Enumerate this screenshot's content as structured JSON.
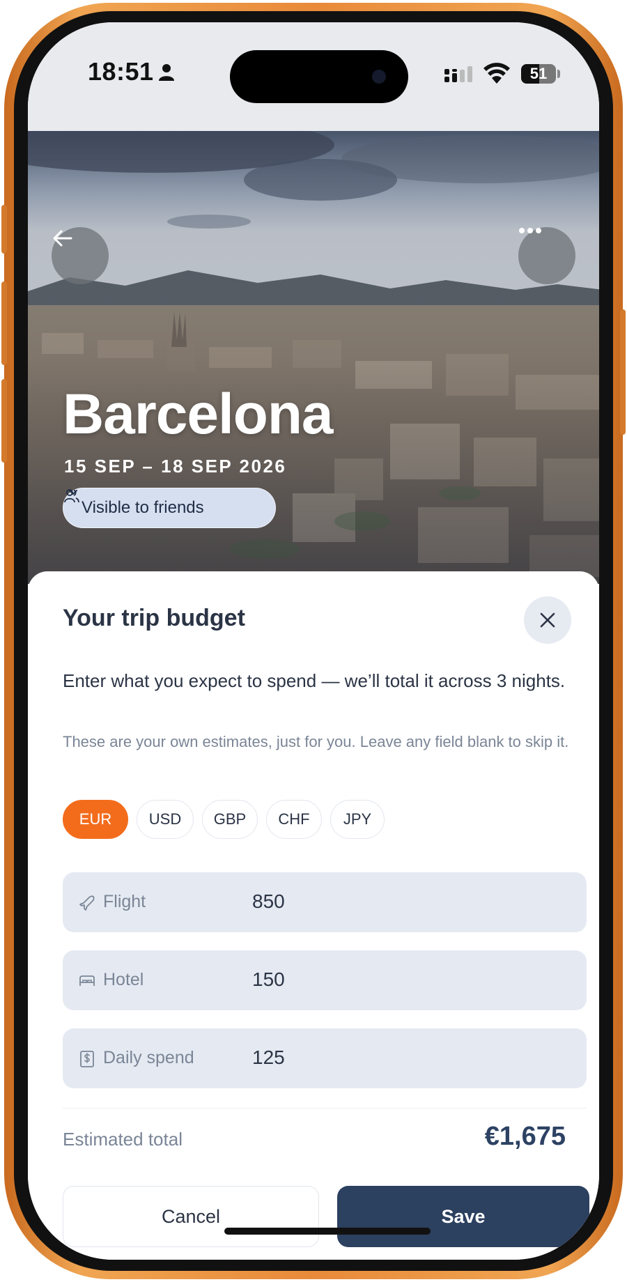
{
  "status_bar": {
    "time": "18:51",
    "battery": "51"
  },
  "hero": {
    "city": "Barcelona",
    "dates": "15 SEP – 18 SEP 2026",
    "visibility_label": "Visible to friends",
    "icons": [
      "arrow-left-icon",
      "more-horizontal-icon",
      "users-icon",
      "chevron-down-icon"
    ]
  },
  "budget": {
    "title": "Your trip budget",
    "intro": "Enter what you expect to spend — we’ll total it across 3 nights.",
    "note": "These are your own estimates, just for you. Leave any field blank to skip it.",
    "currencies": [
      "EUR",
      "USD",
      "GBP",
      "CHF",
      "JPY"
    ],
    "selected_currency": "EUR",
    "fields": [
      {
        "label": "Flight",
        "value": "850",
        "icon": "plane-icon"
      },
      {
        "label": "Hotel",
        "value": "150",
        "icon": "bed-icon"
      },
      {
        "label": "Daily spend",
        "value": "125",
        "icon": "receipt-icon"
      }
    ],
    "total_label": "Estimated total",
    "total_value": "€1,675",
    "cancel_label": "Cancel",
    "save_label": "Save"
  },
  "colors": {
    "accent": "#f36c1c",
    "primary": "#2c4060",
    "frame": "#e88a3a"
  }
}
